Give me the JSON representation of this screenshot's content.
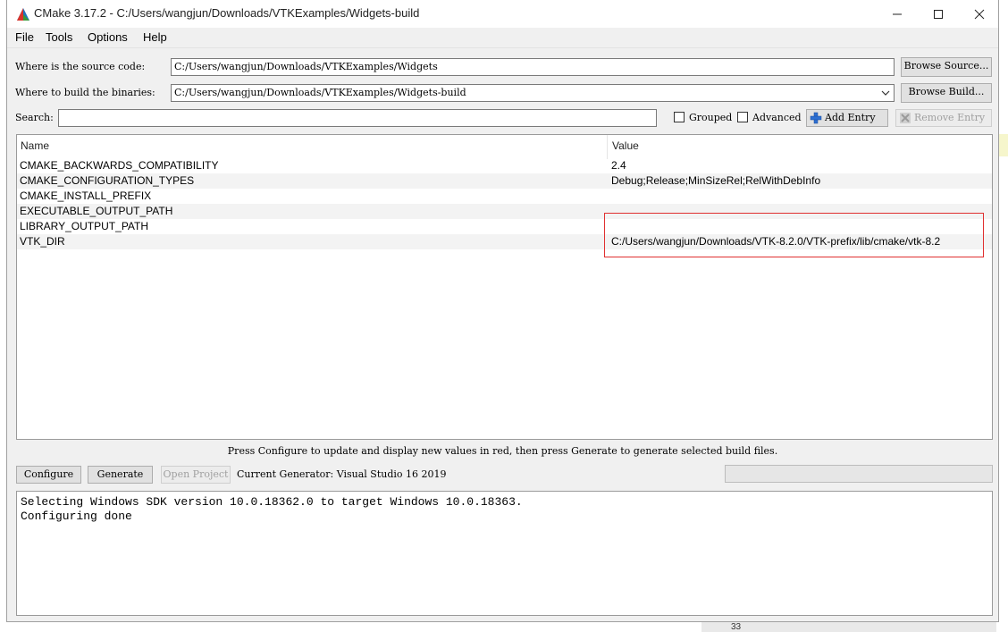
{
  "window": {
    "title": "CMake 3.17.2 - C:/Users/wangjun/Downloads/VTKExamples/Widgets-build"
  },
  "menu": [
    {
      "label": "File"
    },
    {
      "label": "Tools"
    },
    {
      "label": "Options"
    },
    {
      "label": "Help"
    }
  ],
  "source": {
    "label": "Where is the source code:",
    "value": "C:/Users/wangjun/Downloads/VTKExamples/Widgets",
    "browse_label": "Browse Source..."
  },
  "build": {
    "label": "Where to build the binaries:",
    "value": "C:/Users/wangjun/Downloads/VTKExamples/Widgets-build",
    "browse_label": "Browse Build..."
  },
  "search": {
    "label": "Search:",
    "value": "",
    "grouped_label": "Grouped",
    "advanced_label": "Advanced",
    "add_entry_label": "Add Entry",
    "remove_entry_label": "Remove Entry"
  },
  "table": {
    "columns": [
      "Name",
      "Value"
    ],
    "rows": [
      {
        "name": "CMAKE_BACKWARDS_COMPATIBILITY",
        "value": "2.4"
      },
      {
        "name": "CMAKE_CONFIGURATION_TYPES",
        "value": "Debug;Release;MinSizeRel;RelWithDebInfo"
      },
      {
        "name": "CMAKE_INSTALL_PREFIX",
        "value": ""
      },
      {
        "name": "EXECUTABLE_OUTPUT_PATH",
        "value": ""
      },
      {
        "name": "LIBRARY_OUTPUT_PATH",
        "value": ""
      },
      {
        "name": "VTK_DIR",
        "value": "C:/Users/wangjun/Downloads/VTK-8.2.0/VTK-prefix/lib/cmake/vtk-8.2"
      }
    ]
  },
  "hint": "Press Configure to update and display new values in red, then press Generate to generate selected build files.",
  "actions": {
    "configure_label": "Configure",
    "generate_label": "Generate",
    "open_project_label": "Open Project",
    "generator_text": "Current Generator: Visual Studio 16 2019"
  },
  "output": [
    "Selecting Windows SDK version 10.0.18362.0 to target Windows 10.0.18363.",
    "Configuring done"
  ],
  "background_app": {
    "line_number": "33"
  },
  "colors": {
    "highlight_box": "#e03030",
    "window_bg": "#f0f0f0"
  }
}
